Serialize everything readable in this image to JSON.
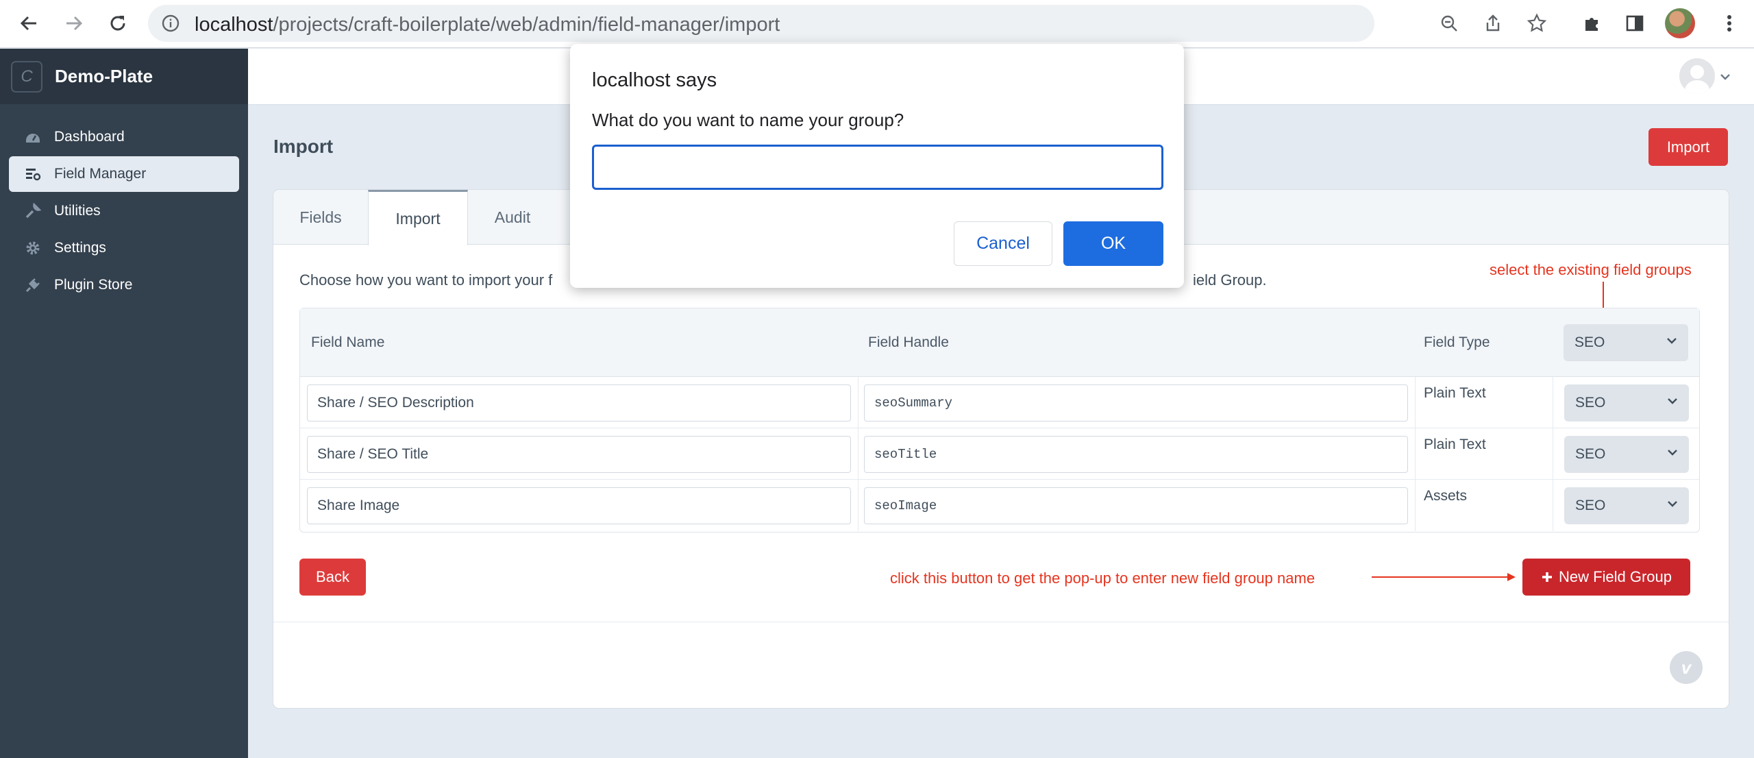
{
  "browser": {
    "url_host": "localhost",
    "url_path": "/projects/craft-boilerplate/web/admin/field-manager/import"
  },
  "sidebar": {
    "logo_letter": "C",
    "site_name": "Demo-Plate",
    "items": [
      {
        "label": "Dashboard",
        "icon": "dashboard-icon"
      },
      {
        "label": "Field Manager",
        "icon": "field-manager-icon"
      },
      {
        "label": "Utilities",
        "icon": "wrench-icon"
      },
      {
        "label": "Settings",
        "icon": "gear-icon"
      },
      {
        "label": "Plugin Store",
        "icon": "plug-icon"
      }
    ]
  },
  "page": {
    "title": "Import",
    "import_button": "Import"
  },
  "tabs": [
    "Fields",
    "Import",
    "Audit"
  ],
  "intro_text": "Choose how you want to import your f",
  "intro_text_tail": "ield Group.",
  "annotations": {
    "select_groups": "select the existing field groups",
    "new_group": "click this button to get the pop-up to enter new field group name"
  },
  "table": {
    "headers": [
      "Field Name",
      "Field Handle",
      "Field Type"
    ],
    "header_group": "SEO",
    "rows": [
      {
        "name": "Share / SEO Description",
        "handle": "seoSummary",
        "type": "Plain Text",
        "group": "SEO"
      },
      {
        "name": "Share / SEO Title",
        "handle": "seoTitle",
        "type": "Plain Text",
        "group": "SEO"
      },
      {
        "name": "Share Image",
        "handle": "seoImage",
        "type": "Assets",
        "group": "SEO"
      }
    ]
  },
  "buttons": {
    "back": "Back",
    "new_field_group": "New Field Group"
  },
  "dialog": {
    "title": "localhost says",
    "message": "What do you want to name your group?",
    "input_value": "",
    "cancel": "Cancel",
    "ok": "OK"
  },
  "colors": {
    "accent_red": "#dd3b3b",
    "dialog_blue": "#1d6de0",
    "annotation_red": "#e5341f"
  }
}
